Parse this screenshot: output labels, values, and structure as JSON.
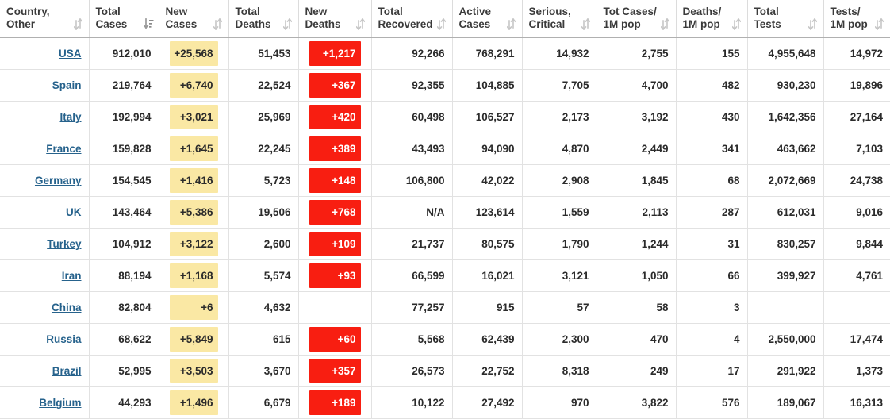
{
  "table": {
    "columns": [
      {
        "label": "Country,\nOther",
        "sort": "both",
        "align": "left"
      },
      {
        "label": "Total\nCases",
        "sort": "desc-active",
        "align": "right"
      },
      {
        "label": "New\nCases",
        "sort": "both",
        "align": "right"
      },
      {
        "label": "Total\nDeaths",
        "sort": "both",
        "align": "right"
      },
      {
        "label": "New\nDeaths",
        "sort": "both",
        "align": "right"
      },
      {
        "label": "Total\nRecovered",
        "sort": "both",
        "align": "right"
      },
      {
        "label": "Active\nCases",
        "sort": "both",
        "align": "right"
      },
      {
        "label": "Serious,\nCritical",
        "sort": "both",
        "align": "right"
      },
      {
        "label": "Tot Cases/\n1M pop",
        "sort": "both",
        "align": "right"
      },
      {
        "label": "Deaths/\n1M pop",
        "sort": "both",
        "align": "right"
      },
      {
        "label": "Total\nTests",
        "sort": "both",
        "align": "right"
      },
      {
        "label": "Tests/\n1M pop",
        "sort": "both",
        "align": "right"
      }
    ],
    "rows": [
      {
        "country": "USA",
        "total_cases": "912,010",
        "new_cases": "+25,568",
        "total_deaths": "51,453",
        "new_deaths": "+1,217",
        "total_recovered": "92,266",
        "active_cases": "768,291",
        "serious_critical": "14,932",
        "tot_cases_per_1m": "2,755",
        "deaths_per_1m": "155",
        "total_tests": "4,955,648",
        "tests_per_1m": "14,972"
      },
      {
        "country": "Spain",
        "total_cases": "219,764",
        "new_cases": "+6,740",
        "total_deaths": "22,524",
        "new_deaths": "+367",
        "total_recovered": "92,355",
        "active_cases": "104,885",
        "serious_critical": "7,705",
        "tot_cases_per_1m": "4,700",
        "deaths_per_1m": "482",
        "total_tests": "930,230",
        "tests_per_1m": "19,896"
      },
      {
        "country": "Italy",
        "total_cases": "192,994",
        "new_cases": "+3,021",
        "total_deaths": "25,969",
        "new_deaths": "+420",
        "total_recovered": "60,498",
        "active_cases": "106,527",
        "serious_critical": "2,173",
        "tot_cases_per_1m": "3,192",
        "deaths_per_1m": "430",
        "total_tests": "1,642,356",
        "tests_per_1m": "27,164"
      },
      {
        "country": "France",
        "total_cases": "159,828",
        "new_cases": "+1,645",
        "total_deaths": "22,245",
        "new_deaths": "+389",
        "total_recovered": "43,493",
        "active_cases": "94,090",
        "serious_critical": "4,870",
        "tot_cases_per_1m": "2,449",
        "deaths_per_1m": "341",
        "total_tests": "463,662",
        "tests_per_1m": "7,103"
      },
      {
        "country": "Germany",
        "total_cases": "154,545",
        "new_cases": "+1,416",
        "total_deaths": "5,723",
        "new_deaths": "+148",
        "total_recovered": "106,800",
        "active_cases": "42,022",
        "serious_critical": "2,908",
        "tot_cases_per_1m": "1,845",
        "deaths_per_1m": "68",
        "total_tests": "2,072,669",
        "tests_per_1m": "24,738"
      },
      {
        "country": "UK",
        "total_cases": "143,464",
        "new_cases": "+5,386",
        "total_deaths": "19,506",
        "new_deaths": "+768",
        "total_recovered": "N/A",
        "active_cases": "123,614",
        "serious_critical": "1,559",
        "tot_cases_per_1m": "2,113",
        "deaths_per_1m": "287",
        "total_tests": "612,031",
        "tests_per_1m": "9,016"
      },
      {
        "country": "Turkey",
        "total_cases": "104,912",
        "new_cases": "+3,122",
        "total_deaths": "2,600",
        "new_deaths": "+109",
        "total_recovered": "21,737",
        "active_cases": "80,575",
        "serious_critical": "1,790",
        "tot_cases_per_1m": "1,244",
        "deaths_per_1m": "31",
        "total_tests": "830,257",
        "tests_per_1m": "9,844"
      },
      {
        "country": "Iran",
        "total_cases": "88,194",
        "new_cases": "+1,168",
        "total_deaths": "5,574",
        "new_deaths": "+93",
        "total_recovered": "66,599",
        "active_cases": "16,021",
        "serious_critical": "3,121",
        "tot_cases_per_1m": "1,050",
        "deaths_per_1m": "66",
        "total_tests": "399,927",
        "tests_per_1m": "4,761"
      },
      {
        "country": "China",
        "total_cases": "82,804",
        "new_cases": "+6",
        "total_deaths": "4,632",
        "new_deaths": "",
        "total_recovered": "77,257",
        "active_cases": "915",
        "serious_critical": "57",
        "tot_cases_per_1m": "58",
        "deaths_per_1m": "3",
        "total_tests": "",
        "tests_per_1m": ""
      },
      {
        "country": "Russia",
        "total_cases": "68,622",
        "new_cases": "+5,849",
        "total_deaths": "615",
        "new_deaths": "+60",
        "total_recovered": "5,568",
        "active_cases": "62,439",
        "serious_critical": "2,300",
        "tot_cases_per_1m": "470",
        "deaths_per_1m": "4",
        "total_tests": "2,550,000",
        "tests_per_1m": "17,474"
      },
      {
        "country": "Brazil",
        "total_cases": "52,995",
        "new_cases": "+3,503",
        "total_deaths": "3,670",
        "new_deaths": "+357",
        "total_recovered": "26,573",
        "active_cases": "22,752",
        "serious_critical": "8,318",
        "tot_cases_per_1m": "249",
        "deaths_per_1m": "17",
        "total_tests": "291,922",
        "tests_per_1m": "1,373"
      },
      {
        "country": "Belgium",
        "total_cases": "44,293",
        "new_cases": "+1,496",
        "total_deaths": "6,679",
        "new_deaths": "+189",
        "total_recovered": "10,122",
        "active_cases": "27,492",
        "serious_critical": "970",
        "tot_cases_per_1m": "3,822",
        "deaths_per_1m": "576",
        "total_tests": "189,067",
        "tests_per_1m": "16,313"
      }
    ]
  },
  "colors": {
    "new_cases_highlight": "#fae8a4",
    "new_deaths_highlight": "#f81e11",
    "link": "#26628c",
    "text": "#2b2b2b",
    "border": "#e2e2e2",
    "header_border": "#b0b0b0"
  }
}
